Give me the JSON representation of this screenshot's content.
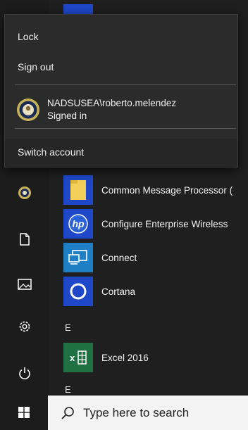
{
  "user_flyout": {
    "lock_label": "Lock",
    "sign_out_label": "Sign out",
    "account_name": "NADSUSEA\\roberto.melendez",
    "account_status": "Signed in",
    "switch_account_label": "Switch account"
  },
  "apps": [
    {
      "label": "Common Message Processor (",
      "icon": "folder-icon",
      "tile_color": "#1f48c9"
    },
    {
      "label": "Configure Enterprise Wireless",
      "icon": "hp-logo-icon",
      "tile_color": "#1f48c9"
    },
    {
      "label": "Connect",
      "icon": "connect-icon",
      "tile_color": "#1e7fc4"
    },
    {
      "label": "Cortana",
      "icon": "cortana-icon",
      "tile_color": "#1f48c9"
    },
    {
      "label": "Excel 2016",
      "icon": "excel-icon",
      "tile_color": "#1f7144"
    }
  ],
  "section_letters": [
    "E",
    "E"
  ],
  "rail_icons": [
    "user-avatar-icon",
    "documents-icon",
    "pictures-icon",
    "settings-icon",
    "power-icon"
  ],
  "taskbar": {
    "search_placeholder": "Type here to search"
  },
  "colors": {
    "start_bg": "#1f1f1f",
    "flyout_bg": "#2b2b2b",
    "accent_blue": "#1f48c9"
  }
}
